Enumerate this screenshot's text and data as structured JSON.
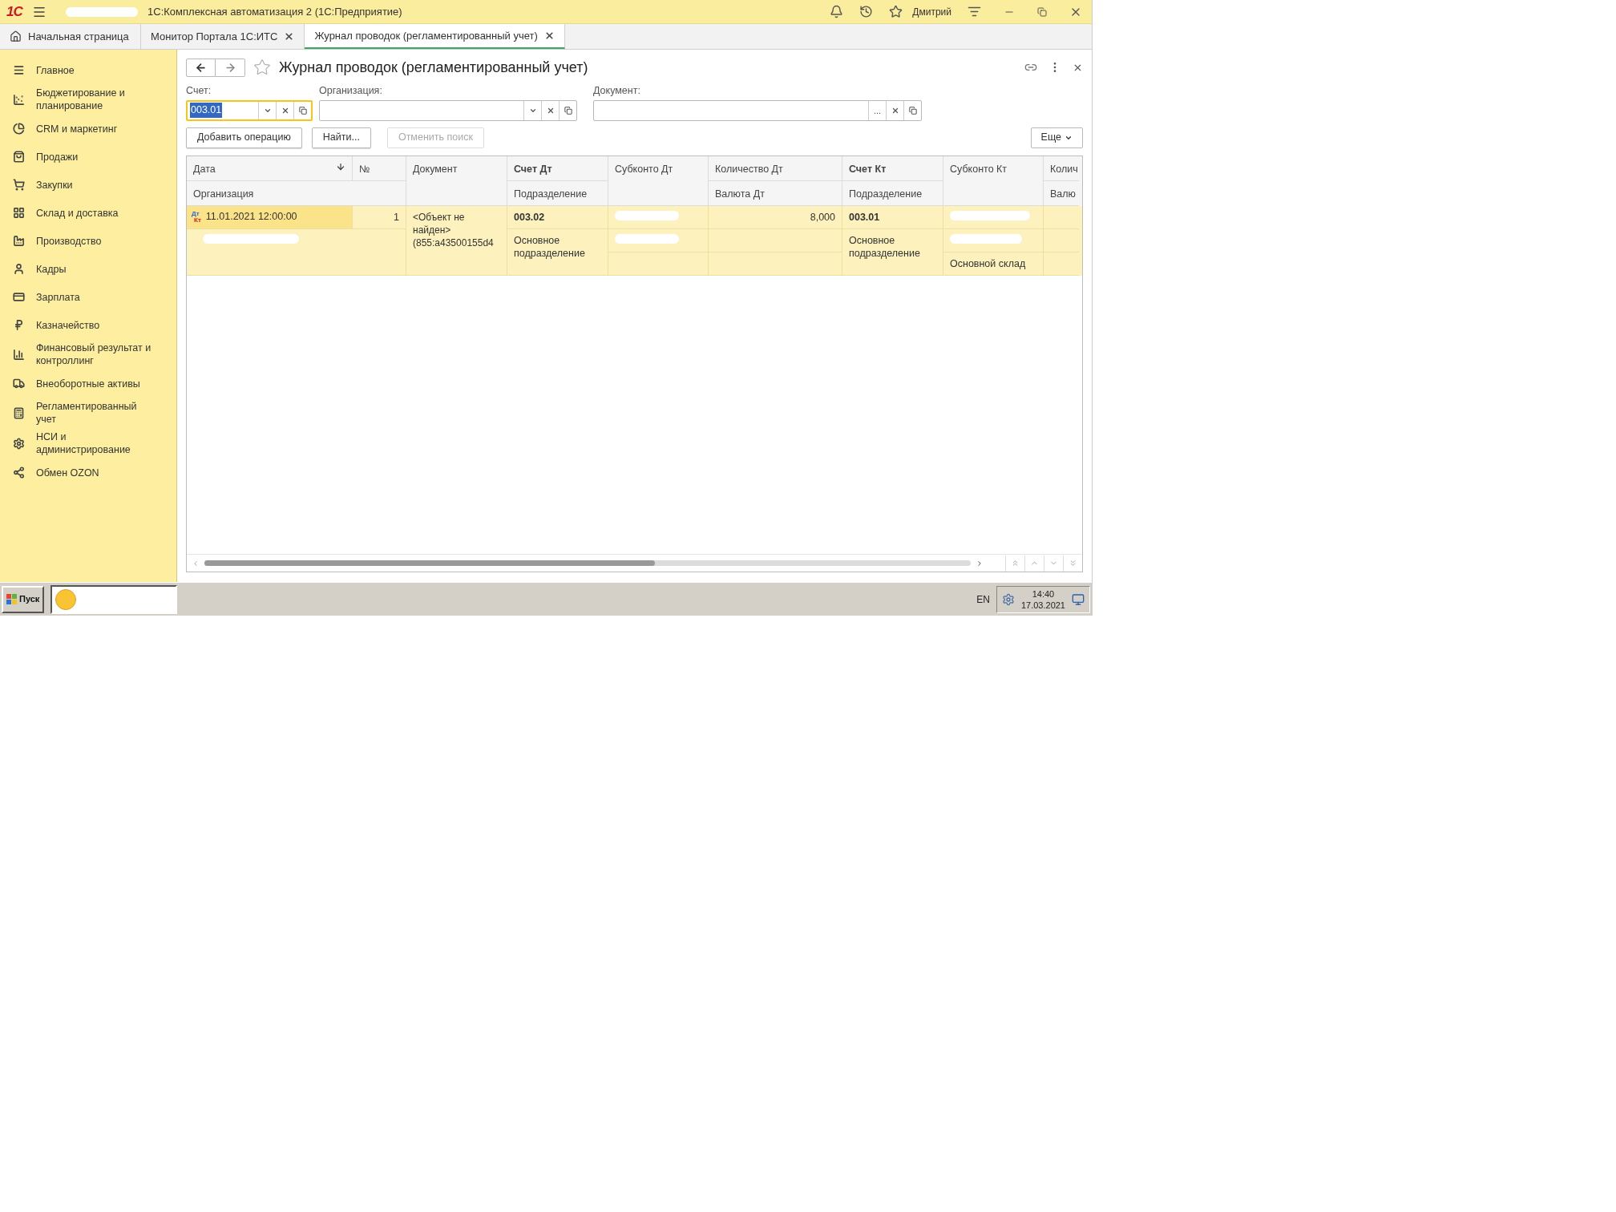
{
  "title_bar": {
    "logo": "1С",
    "title": "1С:Комплексная автоматизация 2  (1С:Предприятие)",
    "user": "Дмитрий"
  },
  "tabs": [
    {
      "label": "Начальная страница",
      "selected": false,
      "closable": false
    },
    {
      "label": "Монитор Портала 1С:ИТС",
      "selected": false,
      "closable": true
    },
    {
      "label": "Журнал проводок (регламентированный учет)",
      "selected": true,
      "closable": true
    }
  ],
  "sidebar": {
    "items": [
      {
        "label": "Главное"
      },
      {
        "label": "Бюджетирование и планирование"
      },
      {
        "label": "CRM и маркетинг"
      },
      {
        "label": "Продажи"
      },
      {
        "label": "Закупки"
      },
      {
        "label": "Склад и доставка"
      },
      {
        "label": "Производство"
      },
      {
        "label": "Кадры"
      },
      {
        "label": "Зарплата"
      },
      {
        "label": "Казначейство"
      },
      {
        "label": "Финансовый результат и контроллинг"
      },
      {
        "label": "Внеоборотные активы"
      },
      {
        "label": "Регламентированный учет"
      },
      {
        "label": "НСИ и администрирование"
      },
      {
        "label": "Обмен OZON"
      }
    ]
  },
  "page": {
    "title": "Журнал проводок (регламентированный учет)",
    "filters": [
      {
        "label": "Счет:",
        "value": "003.01",
        "focused": true,
        "kind": "select"
      },
      {
        "label": "Организация:",
        "focused": false,
        "kind": "select"
      },
      {
        "label": "Документ:",
        "focused": false,
        "kind": "choice",
        "choice": "..."
      }
    ],
    "buttons": [
      {
        "label": "Добавить операцию",
        "disabled": false
      },
      {
        "label": "Найти...",
        "disabled": false
      },
      {
        "label": "Отменить поиск",
        "disabled": true
      }
    ],
    "more_button": "Еще"
  },
  "table": {
    "header": {
      "date": "Дата",
      "number": "№",
      "document": "Документ",
      "account_dt": "Счет Дт",
      "subconto_dt": "Субконто Дт",
      "qty_dt": "Количество Дт",
      "account_kt": "Счет Кт",
      "subconto_kt": "Субконто Кт",
      "column_9": "Колич",
      "organization": "Организация",
      "division_dt": "Подразделение",
      "currency_dt": "Валюта Дт",
      "division_kt": "Подразделение",
      "column_9_sub": "Валю"
    },
    "rows": [
      {
        "selected": true,
        "mark_top": "Дт",
        "mark_bottom": "Кт",
        "date": "11.01.2021 12:00:00",
        "number": "1",
        "document": "<Объект не найден> (855:a43500155d4",
        "account_dt": "003.02",
        "qty_dt": "8,000",
        "division_dt": "Основное подразделение",
        "account_kt": "003.01",
        "division_kt": "Основное подразделение",
        "subconto_kt_3": "Основной склад"
      }
    ]
  },
  "taskbar": {
    "start": "Пуск",
    "language": "EN",
    "time": "14:40",
    "date": "17.03.2021"
  }
}
